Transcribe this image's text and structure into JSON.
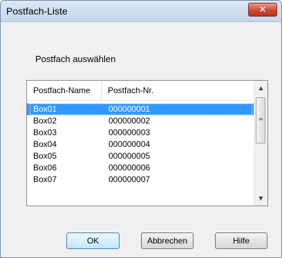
{
  "window": {
    "title": "Postfach-Liste",
    "close_icon": "close-icon"
  },
  "prompt": "Postfach auswählen",
  "list": {
    "columns": [
      "Postfach-Name",
      "Postfach-Nr."
    ],
    "rows": [
      {
        "name": "Box01",
        "number": "000000001",
        "selected": true
      },
      {
        "name": "Box02",
        "number": "000000002",
        "selected": false
      },
      {
        "name": "Box03",
        "number": "000000003",
        "selected": false
      },
      {
        "name": "Box04",
        "number": "000000004",
        "selected": false
      },
      {
        "name": "Box05",
        "number": "000000005",
        "selected": false
      },
      {
        "name": "Box06",
        "number": "000000006",
        "selected": false
      },
      {
        "name": "Box07",
        "number": "000000007",
        "selected": false
      }
    ]
  },
  "buttons": {
    "ok": "OK",
    "cancel": "Abbrechen",
    "help": "Hilfe"
  },
  "colors": {
    "selection": "#3399ff",
    "close_button": "#c9462f"
  }
}
